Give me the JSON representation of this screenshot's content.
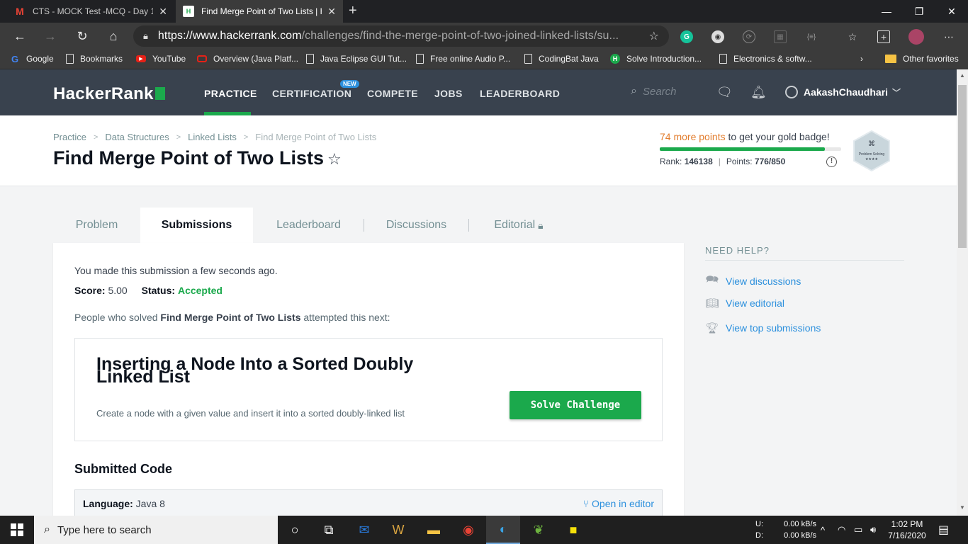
{
  "browser": {
    "tabs": [
      {
        "title": "CTS - MOCK Test -MCQ - Day 1-",
        "icon": "gmail-icon"
      },
      {
        "title": "Find Merge Point of Two Lists | H",
        "icon": "hackerrank-icon"
      }
    ],
    "url_host": "https://www.hackerrank.com",
    "url_path": "/challenges/find-the-merge-point-of-two-joined-linked-lists/su...",
    "bookmarks": [
      {
        "label": "Google",
        "icon": "google-icon"
      },
      {
        "label": "Bookmarks",
        "icon": "page-icon"
      },
      {
        "label": "YouTube",
        "icon": "youtube-icon"
      },
      {
        "label": "Overview (Java Platf...",
        "icon": "oracle-icon"
      },
      {
        "label": "Java Eclipse GUI Tut...",
        "icon": "page-icon"
      },
      {
        "label": "Free online Audio P...",
        "icon": "page-icon"
      },
      {
        "label": "CodingBat Java",
        "icon": "page-icon"
      },
      {
        "label": "Solve Introduction...",
        "icon": "hackerrank-icon"
      },
      {
        "label": "Electronics & softw...",
        "icon": "page-icon"
      }
    ],
    "other_favorites": "Other favorites"
  },
  "nav": {
    "logo": "HackerRank",
    "items": [
      "PRACTICE",
      "CERTIFICATION",
      "COMPETE",
      "JOBS",
      "LEADERBOARD"
    ],
    "new_badge": "NEW",
    "search_placeholder": "Search",
    "username": "AakashChaudhari"
  },
  "page": {
    "breadcrumbs": [
      "Practice",
      "Data Structures",
      "Linked Lists",
      "Find Merge Point of Two Lists"
    ],
    "title": "Find Merge Point of Two Lists",
    "badge_points": "74 more points",
    "badge_rest": " to get your gold badge!",
    "badge_progress_pct": 91,
    "rank_label": "Rank:",
    "rank_value": "146138",
    "points_label": "Points:",
    "points_value": "776/850",
    "badge_name": "Problem Solving",
    "badge_stars": "★★★★"
  },
  "tabs": [
    "Problem",
    "Submissions",
    "Leaderboard",
    "Discussions",
    "Editorial"
  ],
  "submission": {
    "made_text": "You made this submission a few seconds ago.",
    "score_label": "Score:",
    "score_value": "5.00",
    "status_label": "Status:",
    "status_value": "Accepted",
    "people_pre": "People who solved ",
    "people_bold": "Find Merge Point of Two Lists",
    "people_post": " attempted this next:",
    "next_title": "Inserting a Node Into a Sorted Doubly Linked List",
    "next_desc": "Create a node with a given value and insert it into a sorted doubly-linked list",
    "solve_button": "Solve Challenge",
    "submitted_code_heading": "Submitted Code",
    "language_label": "Language:",
    "language_value": "Java 8",
    "open_editor": "Open in editor"
  },
  "help": {
    "heading": "NEED HELP?",
    "items": [
      "View discussions",
      "View editorial",
      "View top submissions"
    ]
  },
  "taskbar": {
    "search_placeholder": "Type here to search",
    "net_up_label": "U:",
    "net_down_label": "D:",
    "net_up": "0.00 kB/s",
    "net_down": "0.00 kB/s",
    "time": "1:02 PM",
    "date": "7/16/2020"
  },
  "colors": {
    "accent_green": "#1ba94c",
    "nav_bg": "#39424e",
    "link_blue": "#2c90dd",
    "points_orange": "#e27d2e"
  }
}
